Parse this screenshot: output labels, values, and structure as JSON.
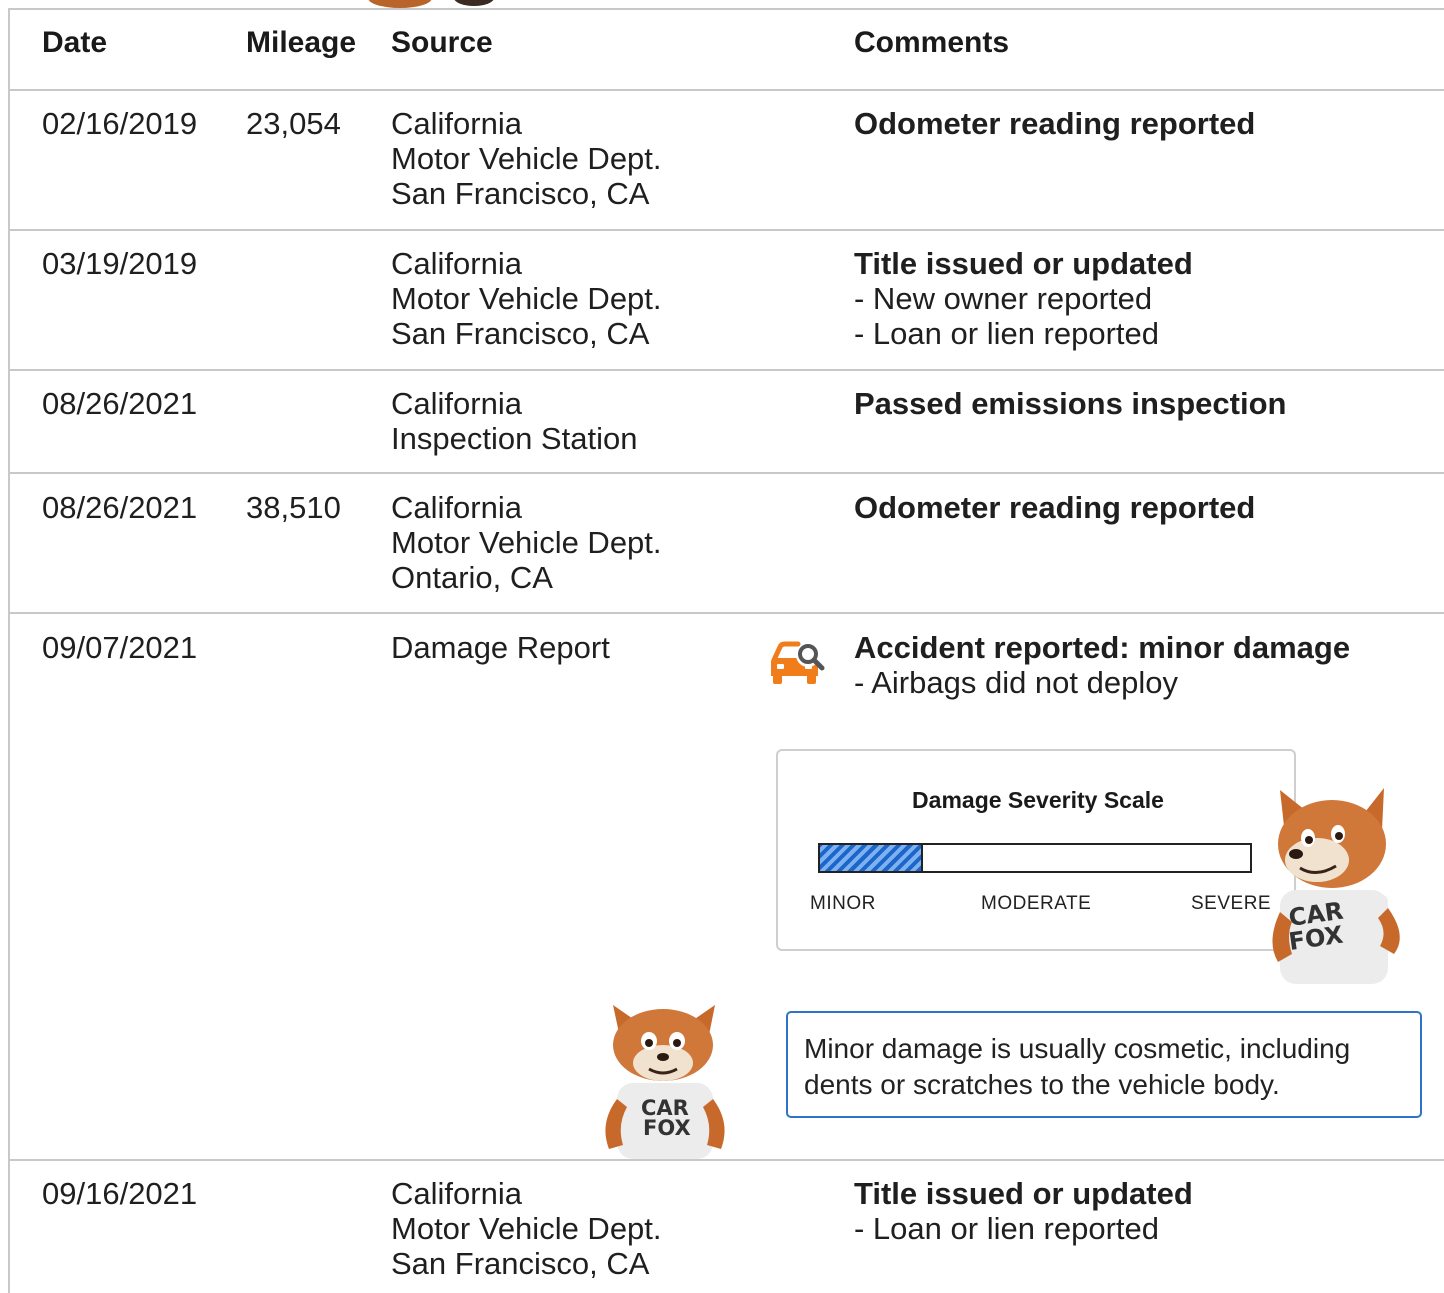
{
  "table": {
    "headers": {
      "date": "Date",
      "mileage": "Mileage",
      "source": "Source",
      "comments": "Comments"
    },
    "rows": [
      {
        "date": "02/16/2019",
        "mileage": "23,054",
        "source": [
          "California",
          "Motor Vehicle Dept.",
          "San Francisco, CA"
        ],
        "title": "Odometer reading reported",
        "details": []
      },
      {
        "date": "03/19/2019",
        "mileage": "",
        "source": [
          "California",
          "Motor Vehicle Dept.",
          "San Francisco, CA"
        ],
        "title": "Title issued or updated",
        "details": [
          "- New owner reported",
          "- Loan or lien reported"
        ]
      },
      {
        "date": "08/26/2021",
        "mileage": "",
        "source": [
          "California",
          "Inspection Station"
        ],
        "title": "Passed emissions inspection",
        "details": []
      },
      {
        "date": "08/26/2021",
        "mileage": "38,510",
        "source": [
          "California",
          "Motor Vehicle Dept.",
          "Ontario, CA"
        ],
        "title": "Odometer reading reported",
        "details": []
      },
      {
        "date": "09/07/2021",
        "mileage": "",
        "source": [
          "Damage Report"
        ],
        "title": "Accident reported: minor damage",
        "details": [
          "- Airbags did not deploy"
        ],
        "icon": "car-damage-icon"
      },
      {
        "date": "09/16/2021",
        "mileage": "",
        "source": [
          "California",
          "Motor Vehicle Dept.",
          "San Francisco, CA"
        ],
        "title": "Title issued or updated",
        "details": [
          "- Loan or lien reported"
        ]
      }
    ]
  },
  "severity_scale": {
    "title": "Damage Severity Scale",
    "labels": {
      "minor": "MINOR",
      "moderate": "MODERATE",
      "severe": "SEVERE"
    },
    "level_fraction": 0.235,
    "fill_color": "#1a66c9"
  },
  "damage_note": "Minor damage is usually cosmetic, including dents or scratches to the vehicle body.",
  "mascot": {
    "shirt_line1": "CAR",
    "shirt_line2": "FOX"
  },
  "colors": {
    "accent_orange": "#f07c1a",
    "note_border": "#2f73c9",
    "rule": "#c8c8c8"
  }
}
